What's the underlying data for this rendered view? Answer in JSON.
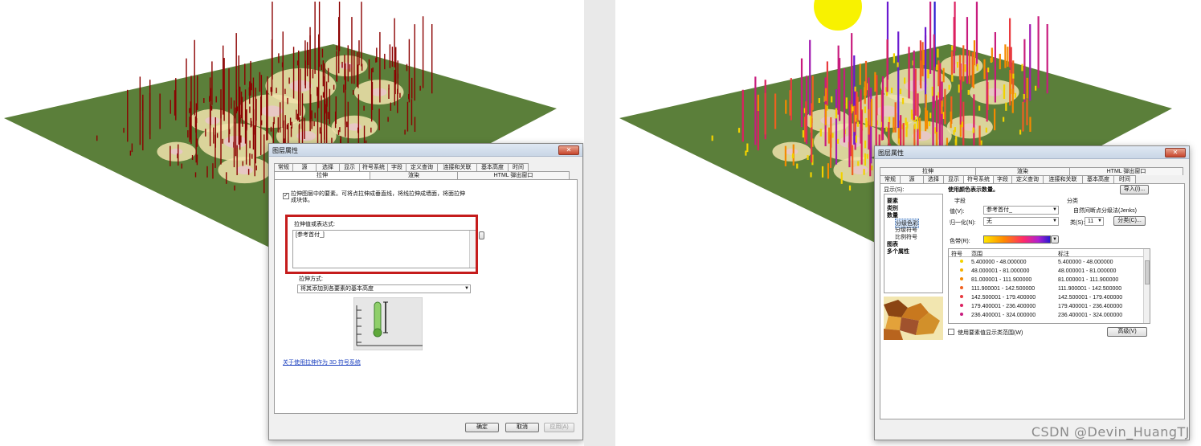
{
  "left_dialog": {
    "title": "图层属性",
    "close_label": "✕",
    "tabs_row1": [
      "常规",
      "源",
      "选择",
      "显示",
      "符号系统",
      "字段",
      "定义查询",
      "连接和关联",
      "基本高度",
      "时间"
    ],
    "tabs_row2": [
      "拉伸",
      "渲染",
      "HTML 弹出窗口"
    ],
    "selected_tab": "拉伸",
    "extrude_checkbox_label": "拉伸图层中的要素。可将点拉伸成垂直线，将线拉伸成墙面，将面拉伸成块体。",
    "extrude_checked": true,
    "expression_label": "拉伸值或表达式:",
    "expression_value": "[参考首付_]",
    "method_label": "拉伸方式:",
    "method_value": "将其添加到各要素的基本高度",
    "help_link": "关于使用拉伸作为 3D 符号系统",
    "ok_label": "确定",
    "cancel_label": "取消",
    "apply_label": "应用(A)"
  },
  "right_dialog": {
    "title": "图层属性",
    "close_label": "✕",
    "tabs_row1": [
      "拉伸",
      "渲染",
      "HTML 弹出窗口"
    ],
    "tabs_row2": [
      "常规",
      "源",
      "选择",
      "显示",
      "符号系统",
      "字段",
      "定义查询",
      "连接和关联",
      "基本高度",
      "时间"
    ],
    "selected_tab": "符号系统",
    "show_label": "显示(S):",
    "tree": [
      {
        "label": "要素",
        "bold": true,
        "indent": 0
      },
      {
        "label": "类别",
        "bold": true,
        "indent": 0
      },
      {
        "label": "数量",
        "bold": true,
        "indent": 0
      },
      {
        "label": "分级色彩",
        "bold": false,
        "indent": 1,
        "selected": true
      },
      {
        "label": "分级符号",
        "bold": false,
        "indent": 1
      },
      {
        "label": "比例符号",
        "bold": false,
        "indent": 1
      },
      {
        "label": "图表",
        "bold": true,
        "indent": 0
      },
      {
        "label": "多个属性",
        "bold": true,
        "indent": 0
      }
    ],
    "heading": "使用颜色表示数量。",
    "import_label": "导入(I)...",
    "fields_group": "字段",
    "value_label": "值(V):",
    "value_field": "参考首付_",
    "normalize_label": "归一化(N):",
    "normalize_field": "无",
    "classification_group": "分类",
    "classification_method": "自然间断点分级法(Jenks)",
    "classes_label": "类(S):",
    "classes_value": "11",
    "classify_button": "分类(C)...",
    "ramp_label": "色带(R):",
    "col_symbol": "符号",
    "col_range": "范围",
    "col_label": "标注",
    "classes": [
      {
        "range": "5.400000 - 48.000000",
        "label": "5.400000 - 48.000000",
        "color": "#f2d200"
      },
      {
        "range": "48.000001 - 81.000000",
        "label": "48.000001 - 81.000000",
        "color": "#f4b000"
      },
      {
        "range": "81.000001 - 111.900000",
        "label": "81.000001 - 111.900000",
        "color": "#f48a00"
      },
      {
        "range": "111.900001 - 142.500000",
        "label": "111.900001 - 142.500000",
        "color": "#f06020"
      },
      {
        "range": "142.500001 - 179.400000",
        "label": "142.500001 - 179.400000",
        "color": "#e83a40"
      },
      {
        "range": "179.400001 - 236.400000",
        "label": "179.400001 - 236.400000",
        "color": "#dc2060"
      },
      {
        "range": "236.400001 - 324.000000",
        "label": "236.400001 - 324.000000",
        "color": "#c81c7e"
      }
    ],
    "show_range_checkbox": "使用要素值显示类范围(W)",
    "advanced_button": "高级(V)"
  },
  "watermark": "CSDN @Devin_HuangTJ",
  "colors": {
    "terrain": "#5b7f3a",
    "hotspot": "#f1e3ad",
    "bars_left": "#8b0000",
    "dialog_bg": "#f0f0f0",
    "highlight_box": "#c51c1c",
    "sun": "#f8f200"
  }
}
